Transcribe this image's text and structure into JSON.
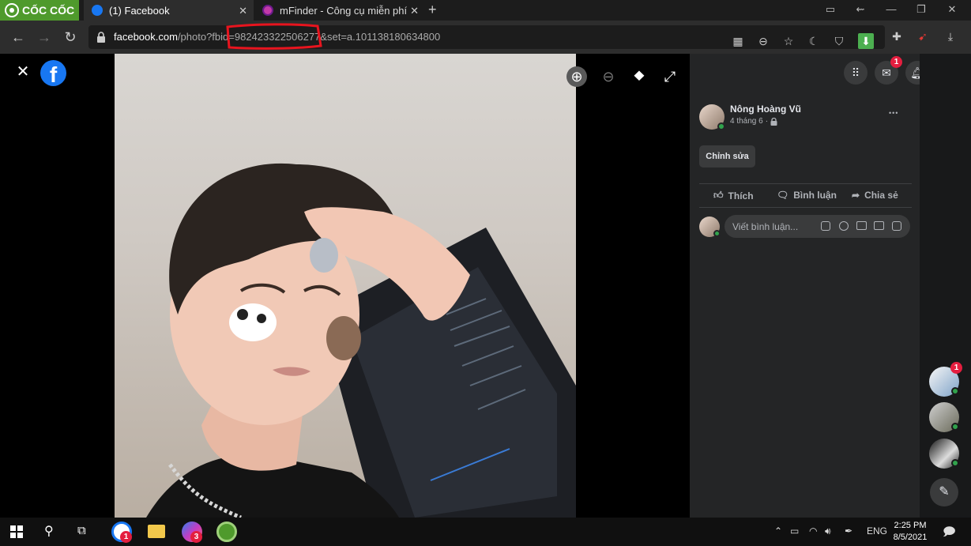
{
  "browser": {
    "brand": "CỐC CỐC",
    "tabs": [
      {
        "title": "(1) Facebook",
        "active": true
      },
      {
        "title": "mFinder - Công cụ miễn phí",
        "active": false
      }
    ],
    "new_tab": "+",
    "url_host": "facebook.com",
    "url_path": "/photo?fbid=982423322506277&set=a.101138180634800"
  },
  "viewer": {
    "close": "✕",
    "fb_logo": "f"
  },
  "post": {
    "author": "Nông Hoàng Vũ",
    "date": "4 tháng 6",
    "date_sep": "·",
    "edit_label": "Chỉnh sửa",
    "more": "•••",
    "actions": {
      "like": "Thích",
      "comment": "Bình luận",
      "share": "Chia sẻ"
    },
    "comment_placeholder": "Viết bình luận..."
  },
  "header": {
    "messenger_badge": "1"
  },
  "contacts": {
    "first_badge": "1"
  },
  "taskbar": {
    "messenger_badge": "3",
    "browser_badge": "1",
    "lang": "ENG",
    "time": "2:25 PM",
    "date": "8/5/2021"
  },
  "colors": {
    "brand_green": "#4f9a2c",
    "fb_blue": "#1877f2",
    "badge_red": "#e41e3f",
    "online_green": "#31a24c",
    "annotation_red": "#e8141e"
  }
}
